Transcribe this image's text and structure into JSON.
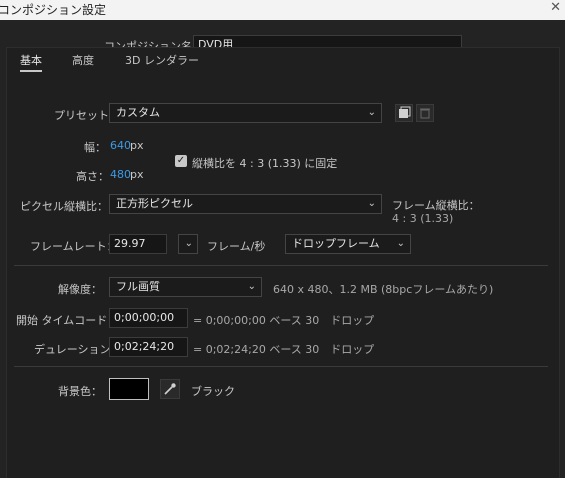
{
  "window": {
    "title": "コンポジション設定",
    "close_glyph": "✕"
  },
  "comp_name": {
    "label": "コンポジション名：",
    "value": "DVD用"
  },
  "tabs": [
    {
      "label": "基本",
      "active": true
    },
    {
      "label": "高度",
      "active": false
    },
    {
      "label": "3D レンダラー",
      "active": false
    }
  ],
  "preset": {
    "label": "プリセット：",
    "value": "カスタム"
  },
  "width": {
    "label": "幅：",
    "value": "640",
    "unit": "px"
  },
  "height": {
    "label": "高さ：",
    "value": "480",
    "unit": "px"
  },
  "aspect_lock": {
    "checked": true,
    "label": "縦横比を 4 : 3 (1.33) に固定"
  },
  "pixel_aspect": {
    "label": "ピクセル縦横比：",
    "value": "正方形ピクセル"
  },
  "frame_aspect": {
    "label": "フレーム縦横比：",
    "value": "4 : 3 (1.33)"
  },
  "frame_rate": {
    "label": "フレームレート：",
    "value": "29.97",
    "unit": "フレーム/秒",
    "drop_value": "ドロップフレーム"
  },
  "resolution": {
    "label": "解像度：",
    "value": "フル画質",
    "info": "640 x 480、1.2 MB (8bpcフレームあたり)"
  },
  "start_timecode": {
    "label": "開始 タイムコード：",
    "value": "0;00;00;00",
    "equiv": "= 0;00;00;00  ベース 30　ドロップ"
  },
  "duration": {
    "label": "デュレーション：",
    "value": "0;02;24;20",
    "equiv": "= 0;02;24;20  ベース 30　ドロップ"
  },
  "background": {
    "label": "背景色：",
    "color": "#000000",
    "name": "ブラック"
  },
  "colors": {
    "accent": "#3c9be6",
    "background": "#1f1f1f",
    "titlebar": "#f3f3f3"
  }
}
